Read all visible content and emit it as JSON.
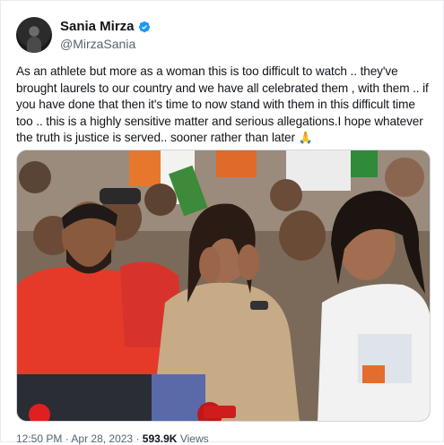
{
  "author": {
    "display_name": "Sania Mirza",
    "handle": "@MirzaSania",
    "verified": true
  },
  "tweet": {
    "text": "As an athlete but more as a woman this is too difficult to watch .. they've brought laurels to our country and we have all celebrated them , with them .. if you have done that then it's time to now stand with them in this difficult time too .. this is a highly sensitive matter and serious allegations.I hope whatever the truth is justice is served.. sooner rather than later",
    "emoji": "folded-hands"
  },
  "media": {
    "alt": "Wrestlers sitting together at a protest"
  },
  "footer": {
    "time": "12:50 PM",
    "date": "Apr 28, 2023",
    "views": "593.9K",
    "views_label": "Views"
  },
  "colors": {
    "verified": "#1d9bf0",
    "text": "#0f1419",
    "muted": "#536471"
  }
}
